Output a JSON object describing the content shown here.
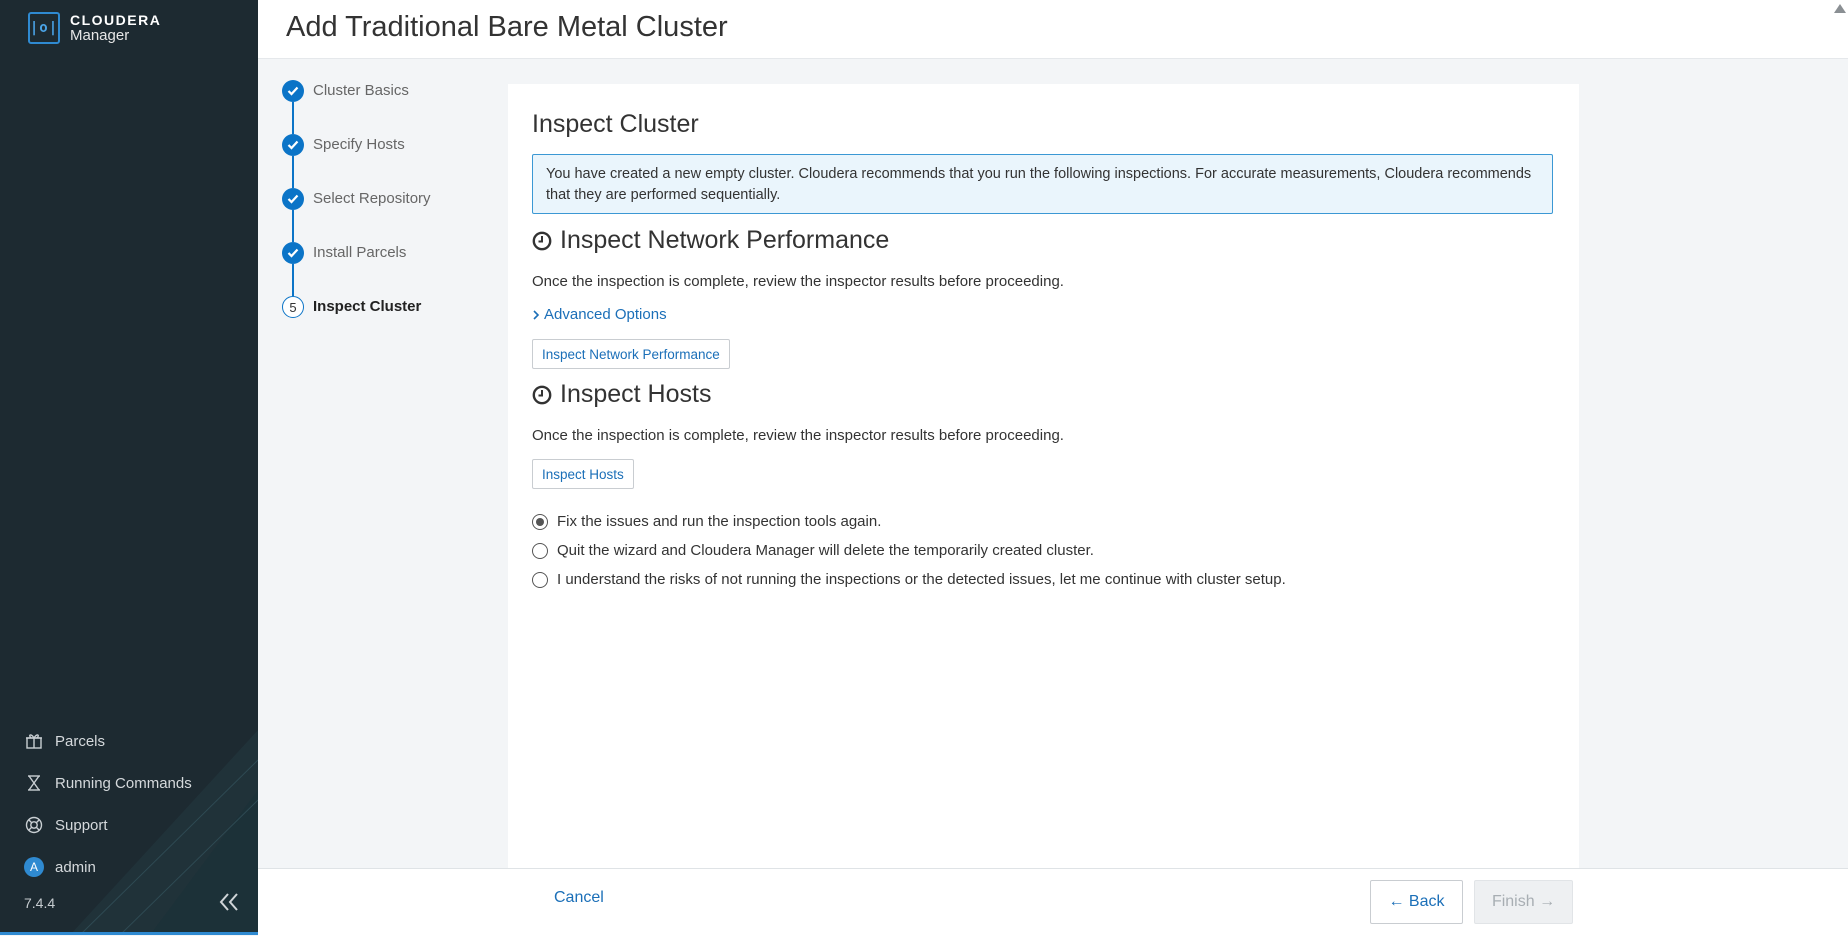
{
  "app": {
    "brand": "CLOUDERA",
    "product": "Manager",
    "logo_glyph": "|o|",
    "version": "7.4.4"
  },
  "sidebar": {
    "items": [
      {
        "label": "Parcels",
        "icon": "gift-icon"
      },
      {
        "label": "Running Commands",
        "icon": "hourglass-icon"
      },
      {
        "label": "Support",
        "icon": "lifebuoy-icon"
      },
      {
        "label": "admin",
        "icon": "avatar",
        "avatar_letter": "A"
      }
    ],
    "collapse_icon": "double-chevron-left-icon"
  },
  "header": {
    "title": "Add Traditional Bare Metal Cluster"
  },
  "wizard": {
    "steps": [
      {
        "label": "Cluster Basics",
        "status": "done"
      },
      {
        "label": "Specify Hosts",
        "status": "done"
      },
      {
        "label": "Select Repository",
        "status": "done"
      },
      {
        "label": "Install Parcels",
        "status": "done"
      },
      {
        "label": "Inspect Cluster",
        "status": "current",
        "number": "5"
      }
    ]
  },
  "main": {
    "title": "Inspect Cluster",
    "info": "You have created a new empty cluster. Cloudera recommends that you run the following inspections. For accurate measurements, Cloudera recommends that they are performed sequentially.",
    "network": {
      "title": "Inspect Network Performance",
      "description": "Once the inspection is complete, review the inspector results before proceeding.",
      "advanced_label": "Advanced Options",
      "button_label": "Inspect Network Performance"
    },
    "hosts": {
      "title": "Inspect Hosts",
      "description": "Once the inspection is complete, review the inspector results before proceeding.",
      "button_label": "Inspect Hosts"
    },
    "options": [
      {
        "label": "Fix the issues and run the inspection tools again.",
        "selected": true
      },
      {
        "label": "Quit the wizard and Cloudera Manager will delete the temporarily created cluster.",
        "selected": false
      },
      {
        "label": "I understand the risks of not running the inspections or the detected issues, let me continue with cluster setup.",
        "selected": false
      }
    ]
  },
  "footer": {
    "cancel_label": "Cancel",
    "back_label": "← Back",
    "finish_label": "Finish →"
  },
  "colors": {
    "sidebar_bg": "#1d2a31",
    "accent": "#0b74c7",
    "link": "#1b6fb8",
    "info_bg": "#eaf5fc",
    "info_border": "#3b98d4"
  }
}
